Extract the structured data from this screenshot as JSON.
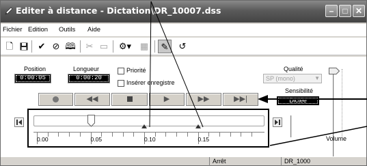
{
  "window": {
    "title": "Editer à distance - Dictation\\DR_10007.dss",
    "icon": "pencil-icon"
  },
  "menu": {
    "items": [
      "Fichier",
      "Edition",
      "Outils",
      "Aide"
    ]
  },
  "toolbar": {
    "icons": [
      "new-icon",
      "save-icon",
      "check-icon",
      "verify-icon",
      "book-icon",
      "cut-icon",
      "paste-icon",
      "settings-dropdown-icon",
      "insert-icon",
      "edit-icon",
      "undo-icon"
    ]
  },
  "controls": {
    "position_label": "Position",
    "position_value": "0:00:05",
    "length_label": "Longueur",
    "length_value": "0:00:20",
    "priority_label": "Priorité",
    "priority_checked": false,
    "insert_label": "Insérer enregistre",
    "insert_checked": false,
    "quality_label": "Qualité",
    "quality_value": "SP (mono)",
    "sensitivity_label": "Sensibilité",
    "sensitivity_value": "Dictée",
    "volume_label": "Volume"
  },
  "playback": {
    "buttons": [
      "record",
      "rewind",
      "stop",
      "play",
      "fast-forward",
      "skip-to-end"
    ]
  },
  "position_slider": {
    "current_seconds": 5,
    "ticks": [
      "0.00",
      "0.05",
      "0.10",
      "0.15"
    ],
    "major_ticks_seconds": [
      0,
      5,
      10,
      15
    ],
    "markers_seconds": [
      10,
      15
    ]
  },
  "status": {
    "state": "Arrêt",
    "file": "DR_1000"
  }
}
